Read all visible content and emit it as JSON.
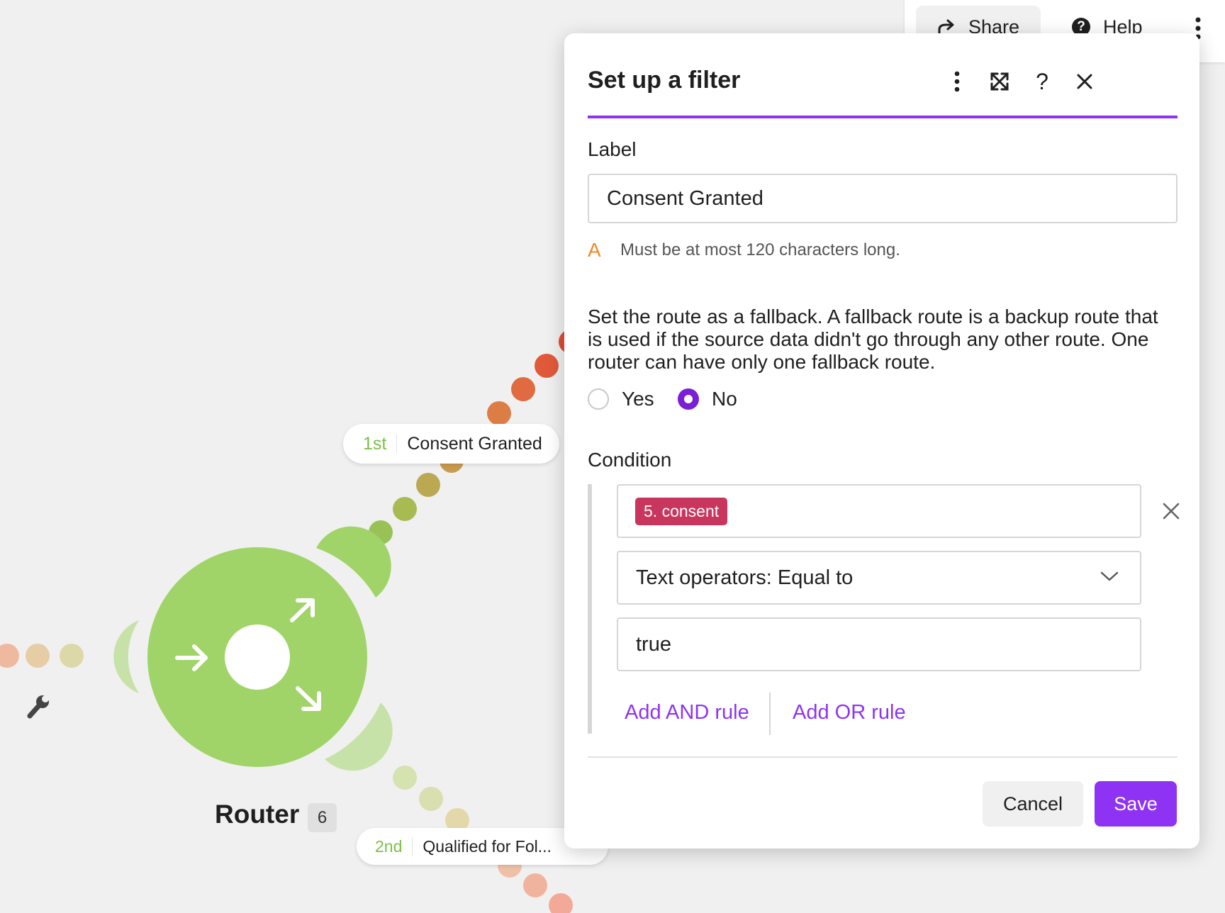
{
  "topbar": {
    "share_label": "Share",
    "help_label": "Help",
    "more_icon": "more-vertical-icon"
  },
  "canvas": {
    "router": {
      "label": "Router",
      "badge": "6",
      "color": "#a0d468"
    },
    "routes": [
      {
        "order": "1st",
        "label": "Consent Granted"
      },
      {
        "order": "2nd",
        "label": "Qualified for Fol..."
      }
    ]
  },
  "panel": {
    "title": "Set up a filter",
    "header_icons": [
      "more-vertical-icon",
      "expand-icon",
      "help-icon",
      "close-icon"
    ],
    "accent_color": "#8e33f3",
    "label_section": {
      "heading": "Label",
      "value": "Consent Granted",
      "warning": "Must be at most 120 characters long."
    },
    "fallback": {
      "description": "Set the route as a fallback. A fallback route is a backup route that is used if the source data didn't go through any other route. One router can have only one fallback route.",
      "options": [
        {
          "label": "Yes",
          "selected": false
        },
        {
          "label": "No",
          "selected": true
        }
      ]
    },
    "condition": {
      "heading": "Condition",
      "field_tag": "5. consent",
      "tag_color": "#c8365e",
      "operator": "Text operators: Equal to",
      "value": "true",
      "add_and": "Add AND rule",
      "add_or": "Add OR rule"
    },
    "buttons": {
      "cancel": "Cancel",
      "save": "Save"
    }
  }
}
